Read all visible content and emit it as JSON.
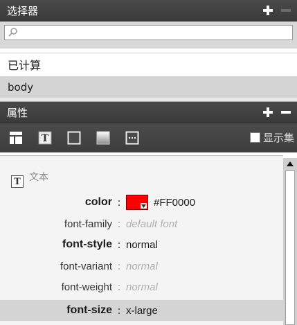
{
  "selectors_panel": {
    "title": "选择器",
    "search_placeholder": "",
    "items": [
      "已计算",
      "body"
    ],
    "selected_index": 1
  },
  "properties_panel": {
    "title": "属性",
    "toolbar": {
      "icons": [
        "layout-icon",
        "text-icon",
        "border-icon",
        "background-icon",
        "more-icon"
      ],
      "show_set_label": "显示集"
    },
    "section_title": "文本",
    "properties": [
      {
        "name": "color",
        "sep": ":",
        "value": "#FF0000",
        "is_set": true
      },
      {
        "name": "font-family",
        "sep": ":",
        "value": "default font",
        "is_set": false
      },
      {
        "name": "font-style",
        "sep": ":",
        "value": "normal",
        "is_set": true
      },
      {
        "name": "font-variant",
        "sep": ":",
        "value": "normal",
        "is_set": false
      },
      {
        "name": "font-weight",
        "sep": ":",
        "value": "normal",
        "is_set": false
      },
      {
        "name": "font-size",
        "sep": ":",
        "value": "x-large",
        "is_set": true
      }
    ]
  },
  "colors": {
    "header_bg": "#3f3f3f",
    "selected_row_bg": "#d4d4d4",
    "color_swatch": "#ff0000"
  }
}
